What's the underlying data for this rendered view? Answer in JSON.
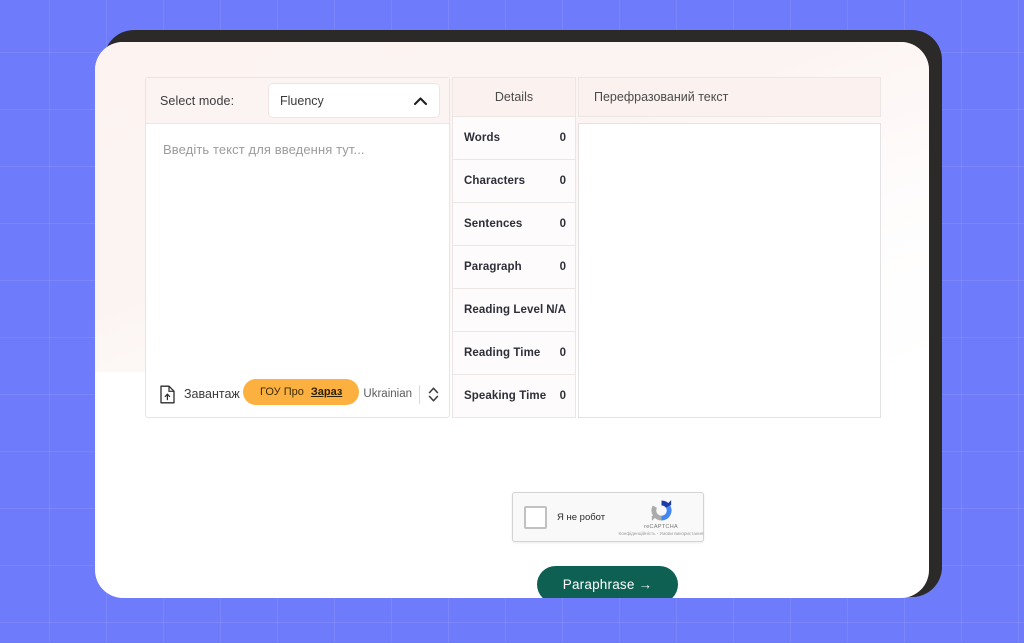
{
  "background": {
    "color": "#6E7BFA",
    "grid": true
  },
  "card": {
    "shadow_color": "#2B2A28",
    "surface_color": "#FFFFFF",
    "tint_color": "#FCF4F2"
  },
  "input_panel": {
    "mode_label": "Select mode:",
    "mode_value": "Fluency",
    "mode_chevron_icon": "chevron-up-icon",
    "placeholder": "Введіть текст для введення тут...",
    "text_value": "",
    "upload_icon": "file-upload-icon",
    "upload_label": "Завантаж",
    "language_value": "Ukrainian",
    "stepper_icon": "chevron-up-down-icon"
  },
  "promo": {
    "text": "ГОУ Про",
    "cta": "Зараз",
    "color": "#FBB040"
  },
  "details": {
    "title": "Details",
    "rows": [
      {
        "key": "Words",
        "value": "0"
      },
      {
        "key": "Characters",
        "value": "0"
      },
      {
        "key": "Sentences",
        "value": "0"
      },
      {
        "key": "Paragraph",
        "value": "0"
      },
      {
        "key": "Reading Level",
        "value": "N/A"
      },
      {
        "key": "Reading Time",
        "value": "0"
      },
      {
        "key": "Speaking Time",
        "value": "0"
      }
    ]
  },
  "output_panel": {
    "title": "Перефразований текст",
    "text_value": ""
  },
  "captcha": {
    "label": "Я не робот",
    "brand": "reCAPTCHA",
    "legal": "Конфіденційність - Умови використання",
    "logo_icon": "recaptcha-logo-icon",
    "checkbox_checked": false
  },
  "submit": {
    "label": "Paraphrase →",
    "color": "#0D6052"
  }
}
